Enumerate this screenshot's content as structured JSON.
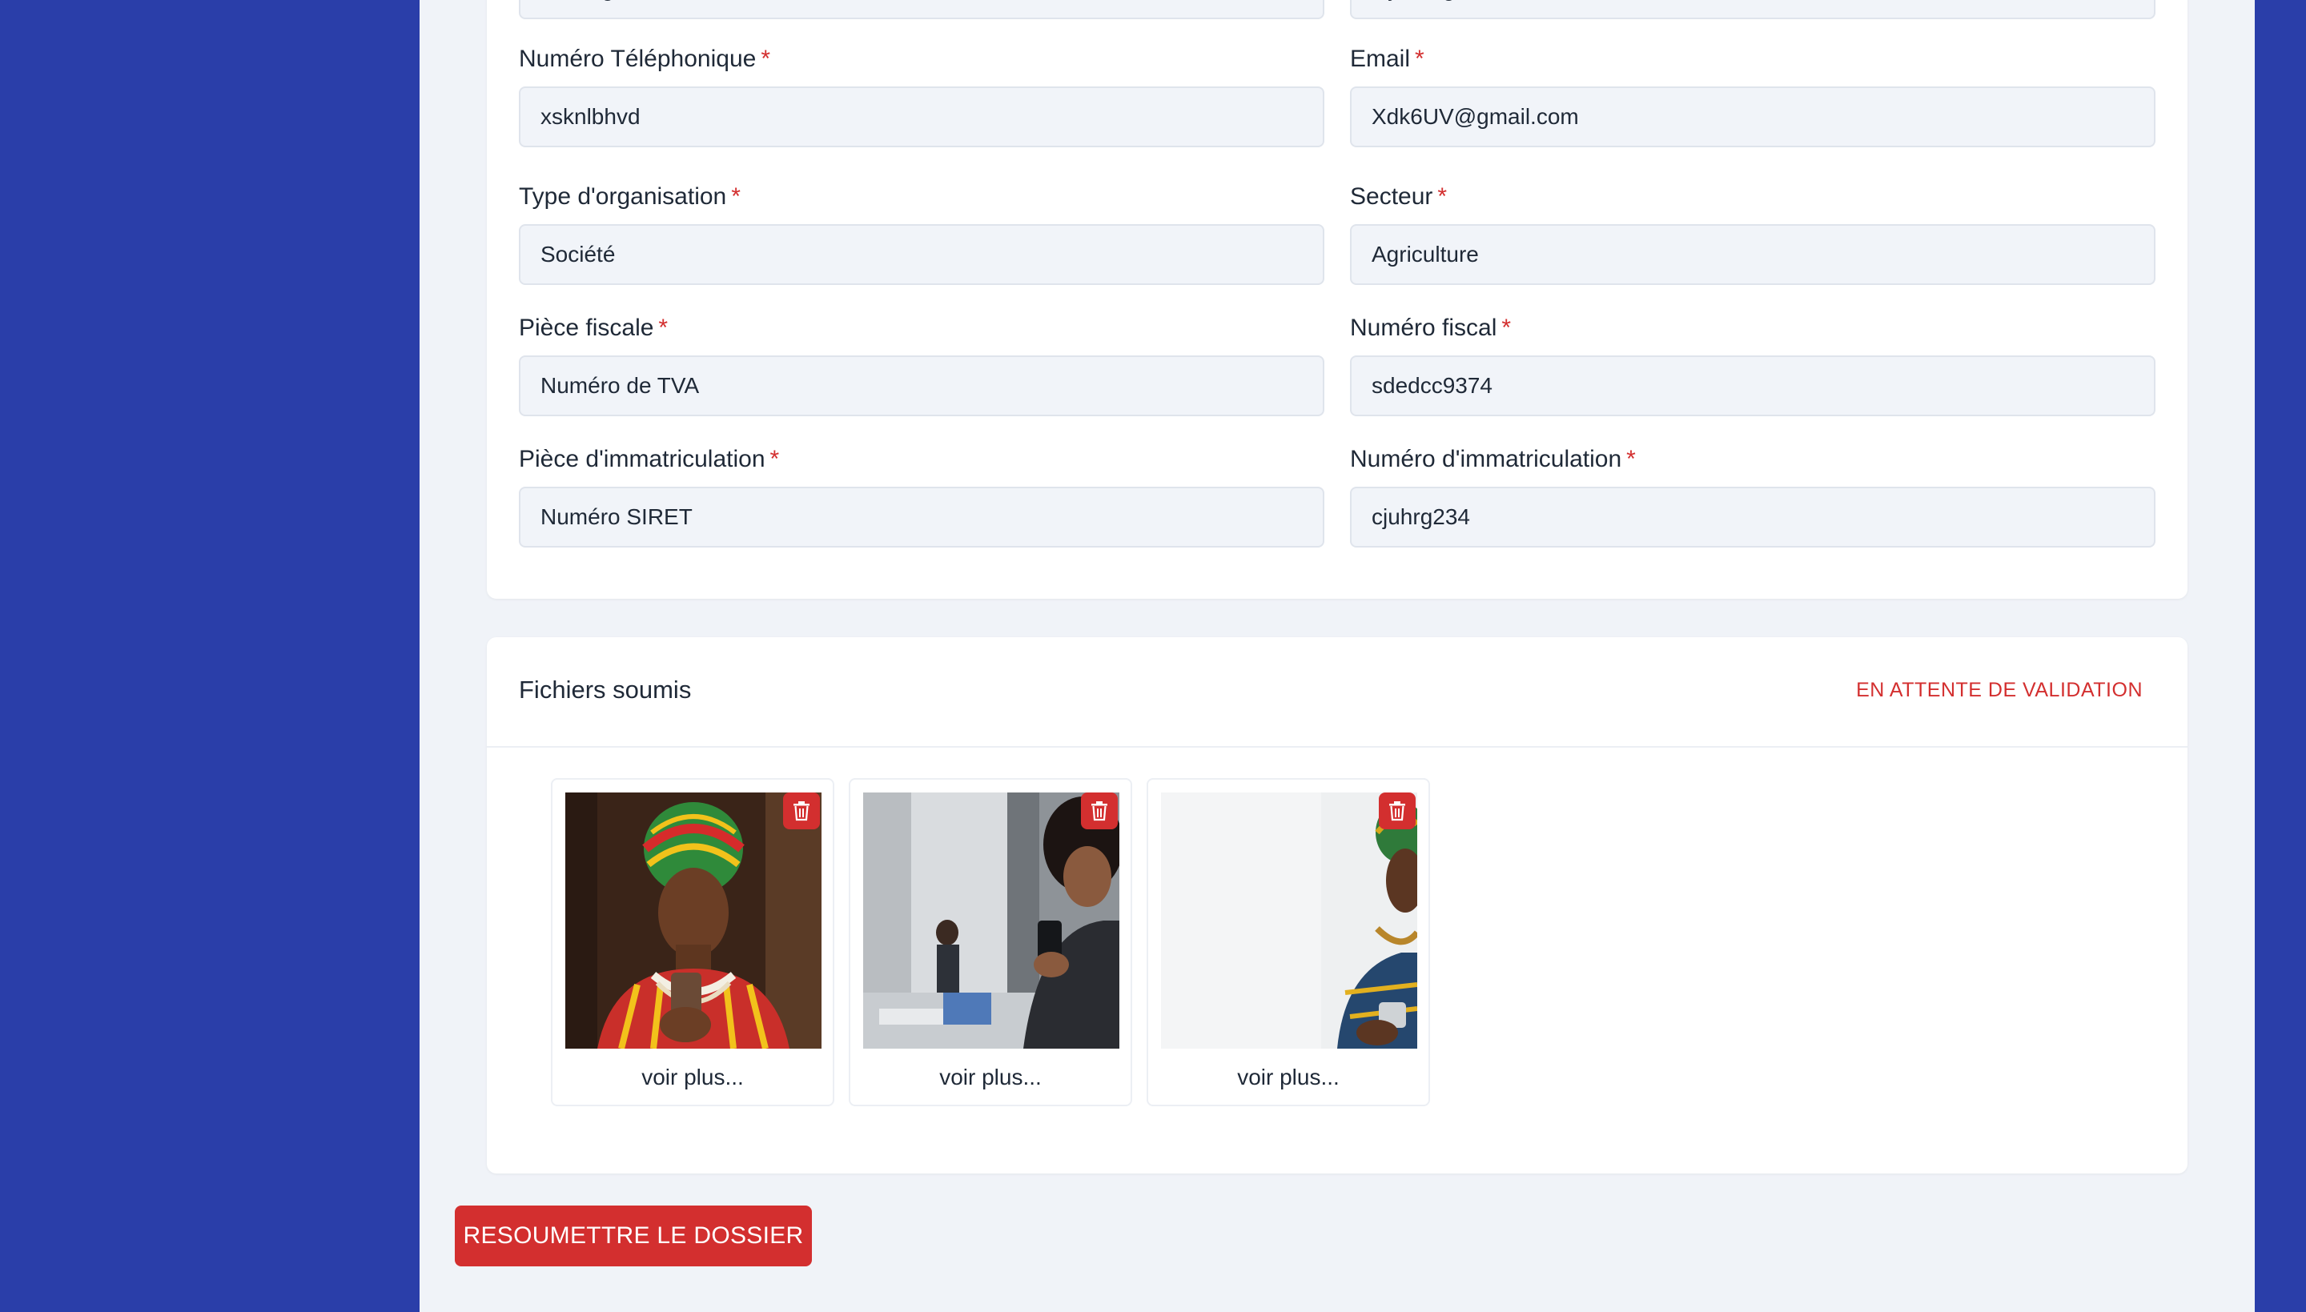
{
  "form": {
    "top_left_value": "nkdhbgv",
    "top_right_value": "eljnkbhg",
    "phone": {
      "label": "Numéro Téléphonique",
      "required_mark": "*",
      "value": "xsknlbhvd"
    },
    "email": {
      "label": "Email",
      "required_mark": "*",
      "value": "Xdk6UV@gmail.com"
    },
    "org_type": {
      "label": "Type d'organisation",
      "required_mark": "*",
      "value": "Société"
    },
    "sector": {
      "label": "Secteur",
      "required_mark": "*",
      "value": "Agriculture"
    },
    "tax_doc": {
      "label": "Pièce fiscale",
      "required_mark": "*",
      "value": "Numéro de TVA"
    },
    "tax_number": {
      "label": "Numéro fiscal",
      "required_mark": "*",
      "value": "sdedcc9374"
    },
    "reg_doc": {
      "label": "Pièce d'immatriculation",
      "required_mark": "*",
      "value": "Numéro SIRET"
    },
    "reg_number": {
      "label": "Numéro d'immatriculation",
      "required_mark": "*",
      "value": "cjuhrg234"
    }
  },
  "files": {
    "title": "Fichiers soumis",
    "status": "EN ATTENTE DE VALIDATION",
    "items": [
      {
        "caption": "voir plus...",
        "icon": "trash-icon"
      },
      {
        "caption": "voir plus...",
        "icon": "trash-icon"
      },
      {
        "caption": "voir plus...",
        "icon": "trash-icon"
      }
    ]
  },
  "actions": {
    "resubmit_label": "RESOUMETTRE LE DOSSIER"
  },
  "colors": {
    "sidebar_blue": "#2a3ea9",
    "page_bg": "#f0f3f8",
    "danger_red": "#d32f2f",
    "input_bg": "#f1f4f9"
  }
}
